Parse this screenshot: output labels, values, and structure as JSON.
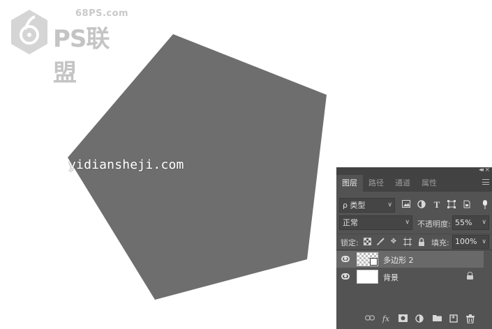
{
  "logo": {
    "site": "68PS.com",
    "brand": "PS联盟"
  },
  "watermark": "yidiansheji.com",
  "canvas": {
    "shape_color": "#6e6e6e",
    "background": "#ffffff"
  },
  "panel": {
    "tabs": [
      {
        "label": "图层",
        "active": true
      },
      {
        "label": "路径",
        "active": false
      },
      {
        "label": "通道",
        "active": false
      },
      {
        "label": "属性",
        "active": false
      }
    ],
    "filter": {
      "kind_label": "类型",
      "search_glyph": "ρ"
    },
    "blend": {
      "mode": "正常",
      "opacity_label": "不透明度:",
      "opacity_value": "55%"
    },
    "lock": {
      "label": "锁定:",
      "fill_label": "填充:",
      "fill_value": "100%"
    },
    "layers": [
      {
        "name": "多边形 2",
        "selected": true,
        "visible": true,
        "type": "shape"
      },
      {
        "name": "背景",
        "selected": false,
        "visible": true,
        "type": "background",
        "locked": true
      }
    ]
  }
}
